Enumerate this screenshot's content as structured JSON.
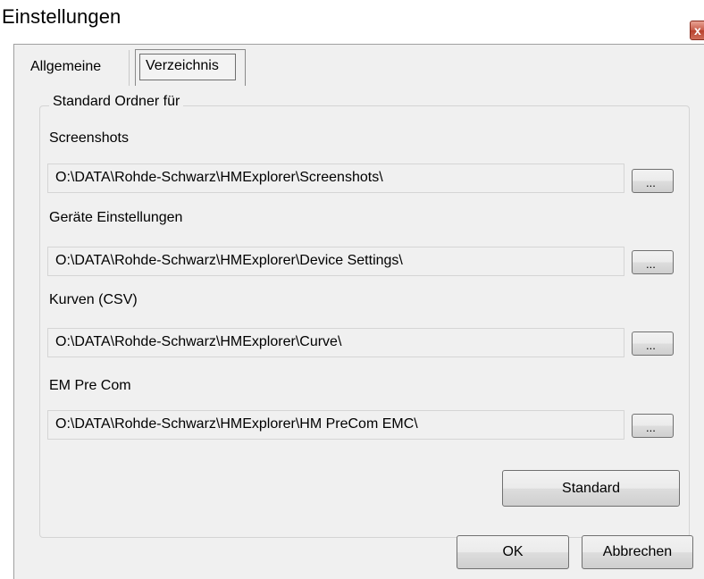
{
  "window": {
    "title": "Einstellungen",
    "close_label": "x"
  },
  "tabs": [
    {
      "label": "Allgemeine"
    },
    {
      "label": "Verzeichnis",
      "selected": true
    }
  ],
  "group": {
    "title": "Standard Ordner für"
  },
  "folders": [
    {
      "label": "Screenshots",
      "path": "O:\\DATA\\Rohde-Schwarz\\HMExplorer\\Screenshots\\",
      "browse_label": "..."
    },
    {
      "label": "Geräte Einstellungen",
      "path": "O:\\DATA\\Rohde-Schwarz\\HMExplorer\\Device Settings\\",
      "browse_label": "..."
    },
    {
      "label": "Kurven (CSV)",
      "path": "O:\\DATA\\Rohde-Schwarz\\HMExplorer\\Curve\\",
      "browse_label": "..."
    },
    {
      "label": "EM Pre Com",
      "path": "O:\\DATA\\Rohde-Schwarz\\HMExplorer\\HM PreCom EMC\\",
      "browse_label": "..."
    }
  ],
  "buttons": {
    "standard": "Standard",
    "ok": "OK",
    "cancel": "Abbrechen"
  }
}
